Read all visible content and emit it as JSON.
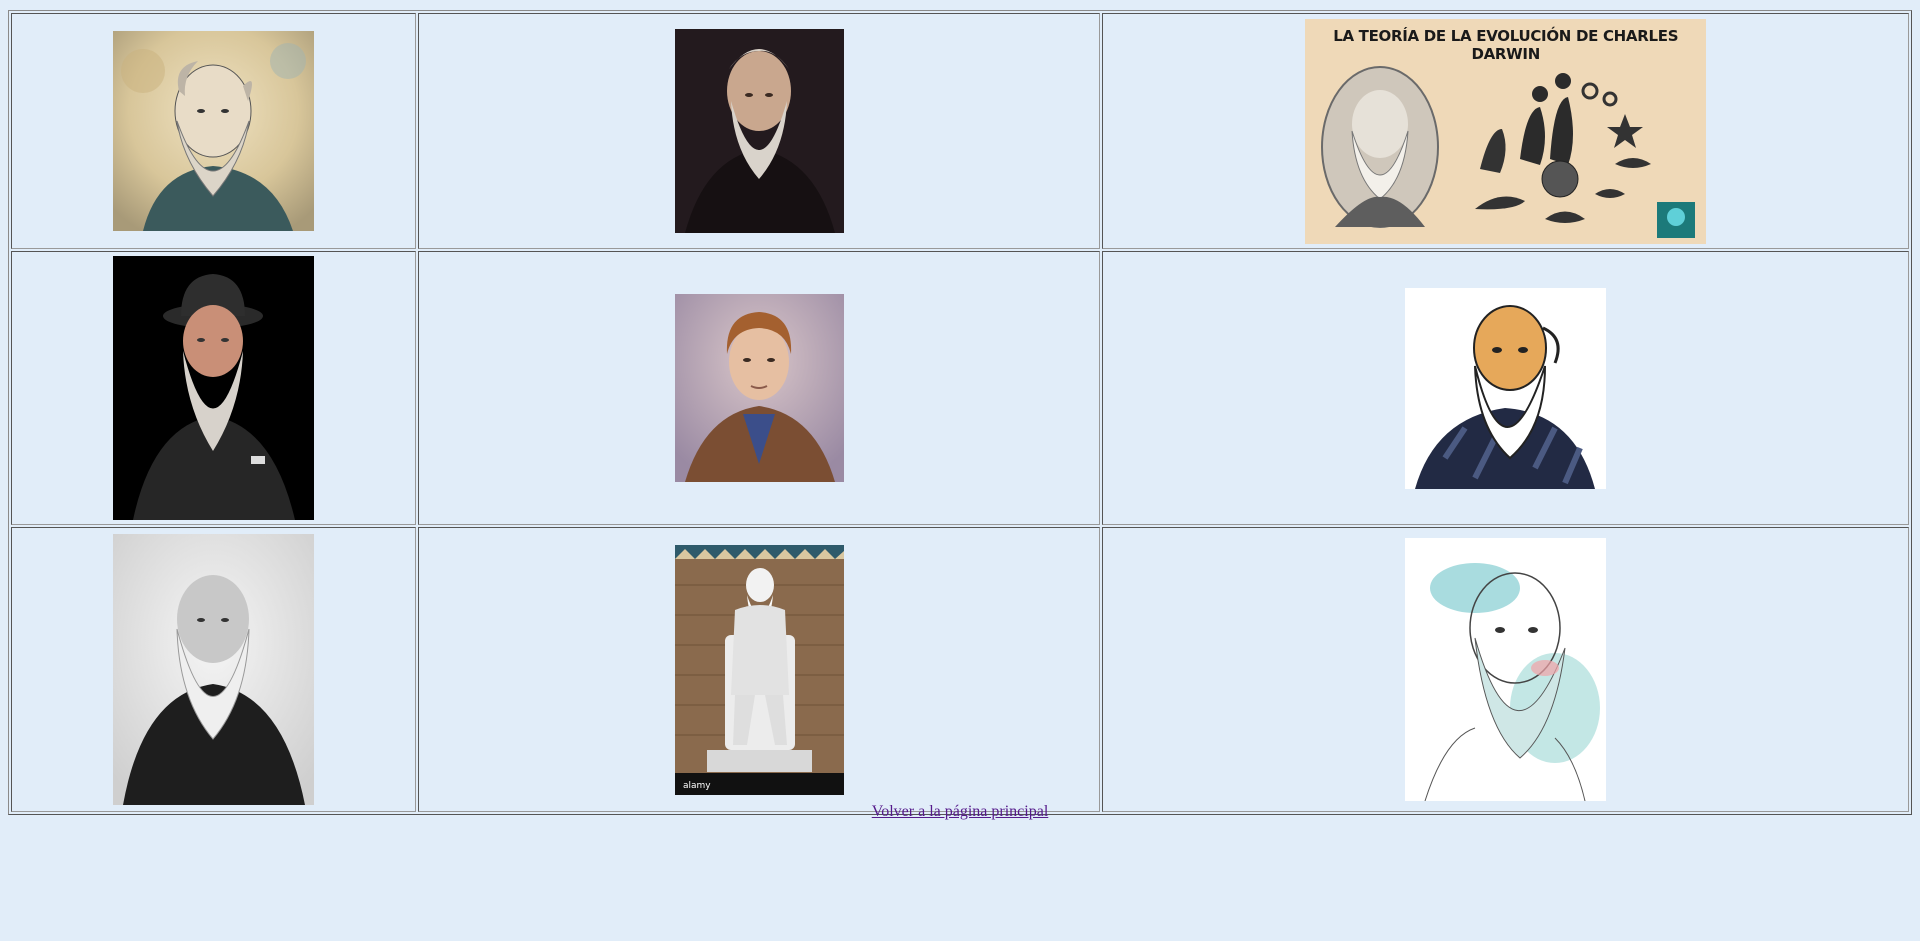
{
  "gallery": {
    "rows": [
      [
        {
          "alt": "engraved-portrait-color",
          "kind": "portrait"
        },
        {
          "alt": "oil-portrait-dark",
          "kind": "portrait"
        },
        {
          "alt": "evolution-banner",
          "kind": "banner"
        }
      ],
      [
        {
          "alt": "wax-figure-bowler-hat",
          "kind": "portrait"
        },
        {
          "alt": "young-darwin-painting",
          "kind": "portrait"
        },
        {
          "alt": "cartoon-illustration",
          "kind": "portrait"
        }
      ],
      [
        {
          "alt": "black-white-photo",
          "kind": "portrait"
        },
        {
          "alt": "marble-statue",
          "kind": "statue"
        },
        {
          "alt": "watercolor-sketch",
          "kind": "portrait"
        }
      ]
    ],
    "banner_title": "LA TEORÍA DE LA EVOLUCIÓN DE CHARLES DARWIN",
    "statue_watermark": "alamy"
  },
  "footer": {
    "back_link": "Volver a la página principal"
  },
  "colors": {
    "page_background": "#e1edf9",
    "link_visited": "#551a8b"
  }
}
